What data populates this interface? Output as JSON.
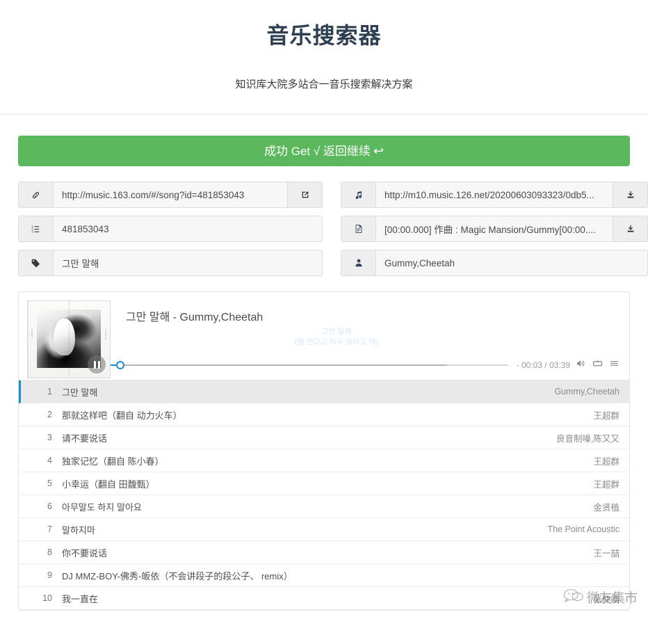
{
  "header": {
    "title": "音乐搜索器",
    "subtitle": "知识库大院多站合一音乐搜索解决方案"
  },
  "banner": {
    "label": "成功 Get √ 返回继续",
    "arrow": "↩",
    "color": "#5cb85c"
  },
  "fields": {
    "page_url": {
      "icon": "link-icon",
      "value": "http://music.163.com/#/song?id=481853043",
      "action_icon": "external-link-icon"
    },
    "song_id": {
      "icon": "ordered-list-icon",
      "value": "481853043"
    },
    "song_title": {
      "icon": "tag-icon",
      "value": "그만 말해"
    },
    "audio_url": {
      "icon": "music-note-icon",
      "value": "http://m10.music.126.net/20200603093323/0db5...",
      "action_icon": "download-icon"
    },
    "lyrics_file": {
      "icon": "document-icon",
      "value": "[00:00.000] 作曲 : Magic Mansion/Gummy[00:00....",
      "action_icon": "download-icon"
    },
    "artist": {
      "icon": "user-icon",
      "value": "Gummy,Cheetah"
    }
  },
  "player": {
    "album_art_alt": "album-cover",
    "play_state_icon": "pause-icon",
    "track_title": "그만 말해 - Gummy,Cheetah",
    "lyric_line_1": "그만 말해",
    "lyric_line_2": "(뭘 안다고 자꾸 뭐라고 해)",
    "time_display": "- 00:03 / 03:39",
    "progress_percent": 1.5,
    "controls": [
      "volume-icon",
      "repeat-icon",
      "playlist-menu-icon"
    ],
    "accent_color": "#1a8cd8"
  },
  "playlist": [
    {
      "index": "1",
      "name": "그만 말해",
      "artist": "Gummy,Cheetah",
      "active": true
    },
    {
      "index": "2",
      "name": "那就这样吧（翻自 动力火车）",
      "artist": "王超群",
      "active": false
    },
    {
      "index": "3",
      "name": "请不要说话",
      "artist": "良音制噪,陈又又",
      "active": false
    },
    {
      "index": "4",
      "name": "独家记忆（翻自 陈小春）",
      "artist": "王超群",
      "active": false
    },
    {
      "index": "5",
      "name": "小幸运（翻自 田馥甄）",
      "artist": "王超群",
      "active": false
    },
    {
      "index": "6",
      "name": "아무말도 하지 말아요",
      "artist": "金贤植",
      "active": false
    },
    {
      "index": "7",
      "name": "말하지마",
      "artist": "The Point Acoustic",
      "active": false
    },
    {
      "index": "8",
      "name": "你不要说话",
      "artist": "王一喆",
      "active": false
    },
    {
      "index": "9",
      "name": "DJ MMZ-BOY-佛秀-皈依（不会讲段子的段公子、 remix）",
      "artist": "",
      "active": false
    },
    {
      "index": "10",
      "name": "我一直在",
      "artist": "张仲皓",
      "active": false
    }
  ],
  "watermark": {
    "icon": "wechat-bubble-icon",
    "text": "微友集市"
  }
}
